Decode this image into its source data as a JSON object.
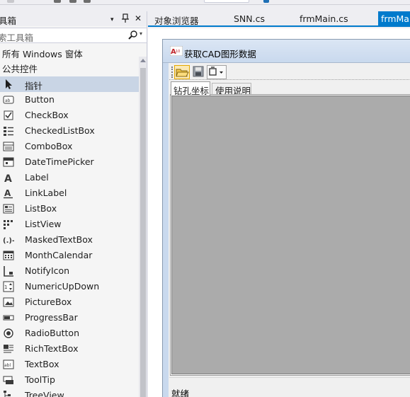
{
  "toolbox": {
    "title": "具箱",
    "pin_glyph": "⊓",
    "close_glyph": "✕",
    "dropdown_glyph": "▾",
    "search_placeholder": "索工具箱",
    "category_all": "所有 Windows 窗体",
    "category_common": "公共控件",
    "items": [
      {
        "label": "指针",
        "icon": "pointer-icon",
        "selected": true
      },
      {
        "label": "Button",
        "icon": "button-icon"
      },
      {
        "label": "CheckBox",
        "icon": "checkbox-icon"
      },
      {
        "label": "CheckedListBox",
        "icon": "checkedlistbox-icon"
      },
      {
        "label": "ComboBox",
        "icon": "combobox-icon"
      },
      {
        "label": "DateTimePicker",
        "icon": "datetimepicker-icon"
      },
      {
        "label": "Label",
        "icon": "label-icon"
      },
      {
        "label": "LinkLabel",
        "icon": "linklabel-icon"
      },
      {
        "label": "ListBox",
        "icon": "listbox-icon"
      },
      {
        "label": "ListView",
        "icon": "listview-icon"
      },
      {
        "label": "MaskedTextBox",
        "icon": "maskedtextbox-icon"
      },
      {
        "label": "MonthCalendar",
        "icon": "monthcalendar-icon"
      },
      {
        "label": "NotifyIcon",
        "icon": "notifyicon-icon"
      },
      {
        "label": "NumericUpDown",
        "icon": "numericupdown-icon"
      },
      {
        "label": "PictureBox",
        "icon": "picturebox-icon"
      },
      {
        "label": "ProgressBar",
        "icon": "progressbar-icon"
      },
      {
        "label": "RadioButton",
        "icon": "radiobutton-icon"
      },
      {
        "label": "RichTextBox",
        "icon": "richtextbox-icon"
      },
      {
        "label": "TextBox",
        "icon": "textbox-icon"
      },
      {
        "label": "ToolTip",
        "icon": "tooltip-icon"
      },
      {
        "label": "TreeView",
        "icon": "treeview-icon"
      }
    ]
  },
  "doc_tabs": [
    {
      "label": "对象浏览器"
    },
    {
      "label": "SNN.cs"
    },
    {
      "label": "frmMain.cs"
    },
    {
      "label": "frmMain",
      "active": true
    }
  ],
  "form": {
    "title": "获取CAD图形数据",
    "toolstrip": [
      "open-folder-icon",
      "save-icon",
      "dropdown-button-icon"
    ],
    "tabs": [
      {
        "label": "钻孔坐标",
        "selected": true
      },
      {
        "label": "使用说明"
      }
    ],
    "status": "就绪"
  },
  "colors": {
    "accent": "#007acc",
    "selection": "#c9d5e5",
    "panel_bg": "#f5f5f5",
    "grid_grey": "#ababab"
  }
}
